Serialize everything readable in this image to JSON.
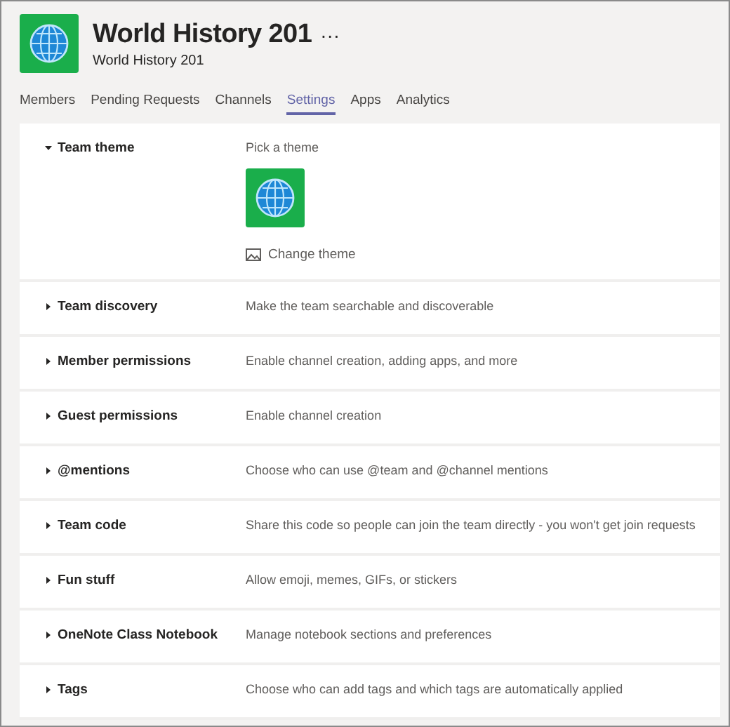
{
  "team": {
    "name": "World History 201",
    "subtitle": "World History 201",
    "more": "···"
  },
  "tabs": [
    {
      "label": "Members",
      "selected": false
    },
    {
      "label": "Pending Requests",
      "selected": false
    },
    {
      "label": "Channels",
      "selected": false
    },
    {
      "label": "Settings",
      "selected": true
    },
    {
      "label": "Apps",
      "selected": false
    },
    {
      "label": "Analytics",
      "selected": false
    }
  ],
  "settings": [
    {
      "label": "Team theme",
      "description": "Pick a theme",
      "expanded": true,
      "action": "Change theme"
    },
    {
      "label": "Team discovery",
      "description": "Make the team searchable and discoverable",
      "expanded": false
    },
    {
      "label": "Member permissions",
      "description": "Enable channel creation, adding apps, and more",
      "expanded": false
    },
    {
      "label": "Guest permissions",
      "description": "Enable channel creation",
      "expanded": false
    },
    {
      "label": "@mentions",
      "description": "Choose who can use @team and @channel mentions",
      "expanded": false
    },
    {
      "label": "Team code",
      "description": "Share this code so people can join the team directly - you won't get join requests",
      "expanded": false
    },
    {
      "label": "Fun stuff",
      "description": "Allow emoji, memes, GIFs, or stickers",
      "expanded": false
    },
    {
      "label": "OneNote Class Notebook",
      "description": "Manage notebook sections and preferences",
      "expanded": false
    },
    {
      "label": "Tags",
      "description": "Choose who can add tags and which tags are automatically applied",
      "expanded": false
    }
  ]
}
